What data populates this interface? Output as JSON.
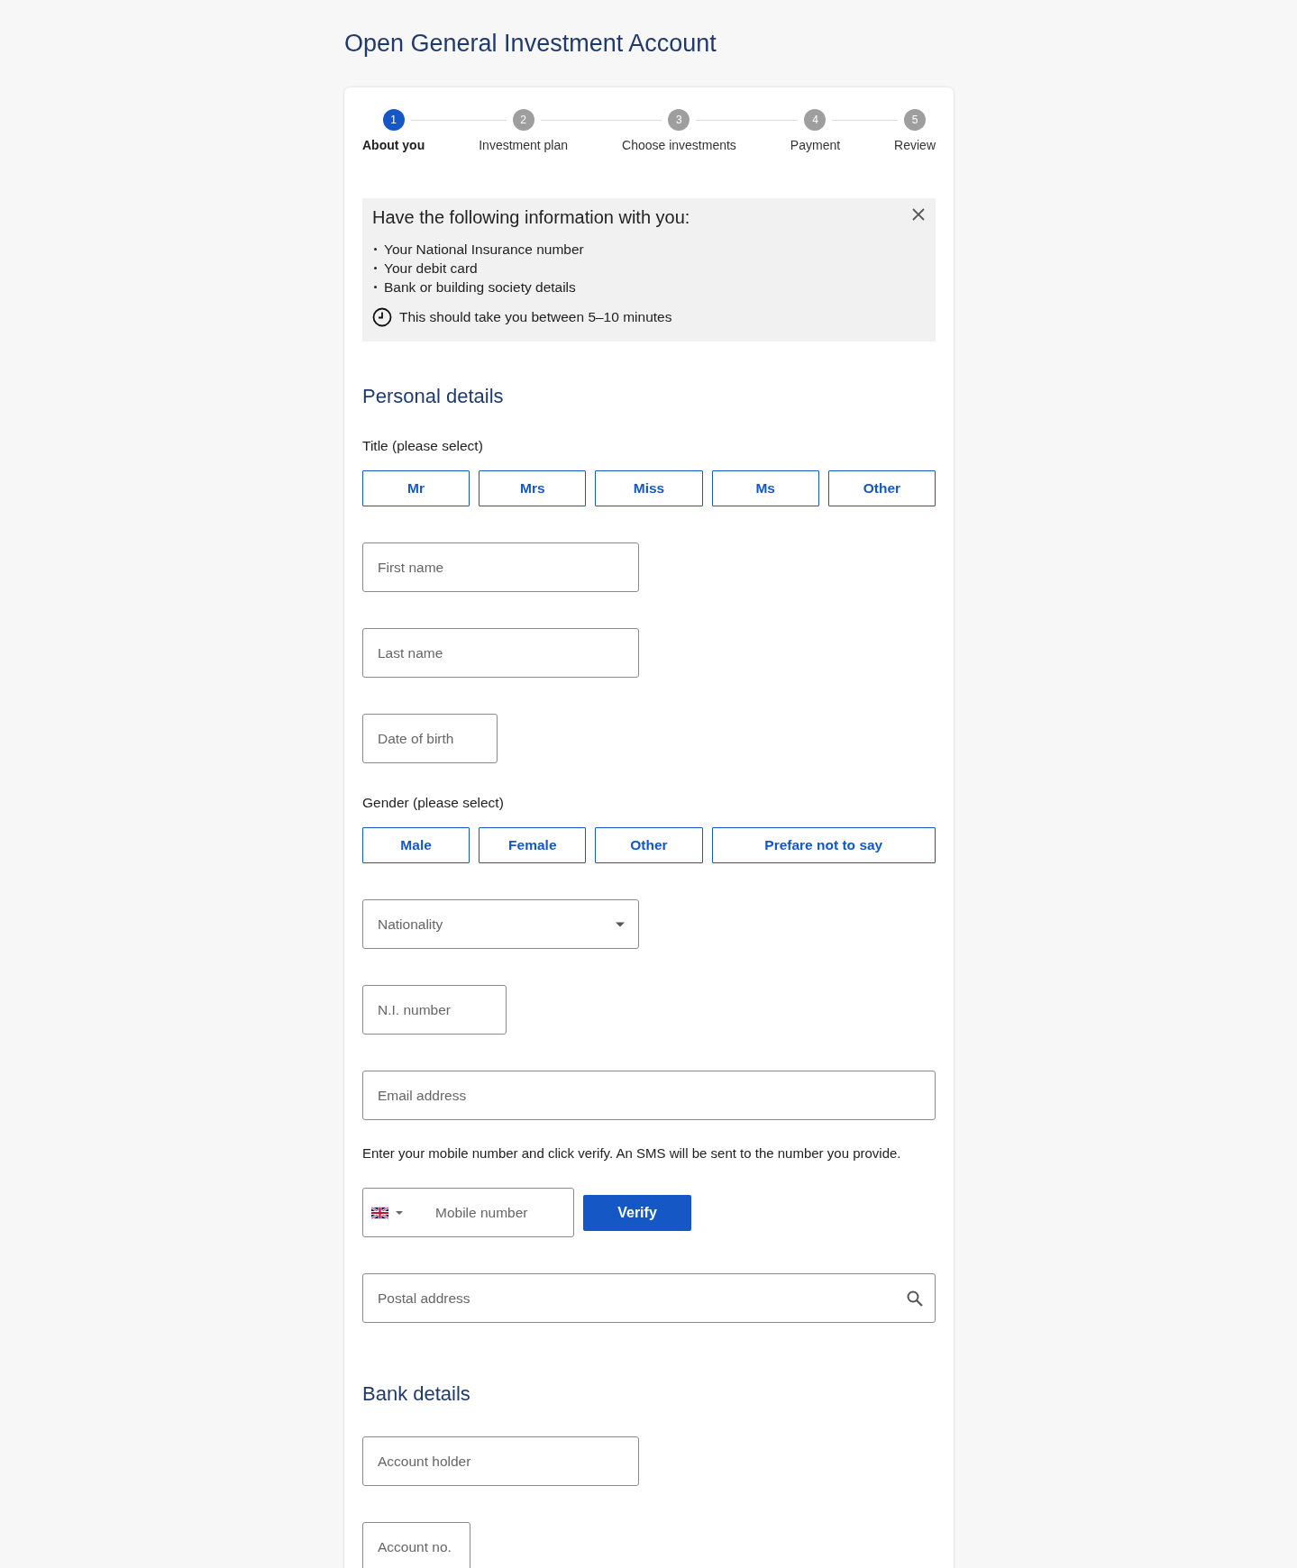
{
  "page_title": "Open General Investment Account",
  "stepper": [
    {
      "number": "1",
      "label": "About you",
      "selected": true
    },
    {
      "number": "2",
      "label": "Investment plan",
      "selected": false
    },
    {
      "number": "3",
      "label": "Choose investments",
      "selected": false
    },
    {
      "number": "4",
      "label": "Payment",
      "selected": false
    },
    {
      "number": "5",
      "label": "Review",
      "selected": false
    }
  ],
  "info_box": {
    "heading": "Have the following information with you:",
    "items": [
      "Your National Insurance number",
      "Your debit card",
      "Bank or building society details"
    ],
    "duration": "This should take you between 5–10 minutes"
  },
  "sections": [
    {
      "heading": "Personal details",
      "items": [
        {
          "kind": "label",
          "text": "Title (please select)"
        },
        {
          "kind": "choices",
          "options": [
            {
              "label": "Mr",
              "selected": false
            },
            {
              "label": "Mrs",
              "selected": false
            },
            {
              "label": "Miss",
              "selected": false
            },
            {
              "label": "Ms",
              "selected": false
            },
            {
              "label": "Other",
              "selected": false
            }
          ]
        },
        {
          "kind": "field",
          "placeholder": "First name"
        },
        {
          "kind": "field",
          "placeholder": "Last name"
        },
        {
          "kind": "field",
          "placeholder": "Date of birth"
        },
        {
          "kind": "label",
          "text": "Gender (please select)"
        },
        {
          "kind": "choices",
          "options": [
            {
              "label": "Male",
              "selected": false
            },
            {
              "label": "Female",
              "selected": false
            },
            {
              "label": "Other",
              "selected": false
            },
            {
              "label": "Prefare not to say",
              "selected": false
            }
          ]
        },
        {
          "kind": "select",
          "placeholder": "Nationality"
        },
        {
          "kind": "field",
          "placeholder": "N.I. number"
        },
        {
          "kind": "field",
          "placeholder": "Email address"
        },
        {
          "kind": "text",
          "text": "Enter your mobile number and click verify. An SMS will be sent to the number you provide."
        },
        {
          "kind": "phone",
          "placeholder": "Mobile number",
          "button": "Verify"
        },
        {
          "kind": "search",
          "placeholder": "Postal address"
        }
      ]
    },
    {
      "heading": "Bank details",
      "items": [
        {
          "kind": "field",
          "placeholder": "Account holder"
        },
        {
          "kind": "field",
          "placeholder": "Account no."
        }
      ]
    }
  ]
}
